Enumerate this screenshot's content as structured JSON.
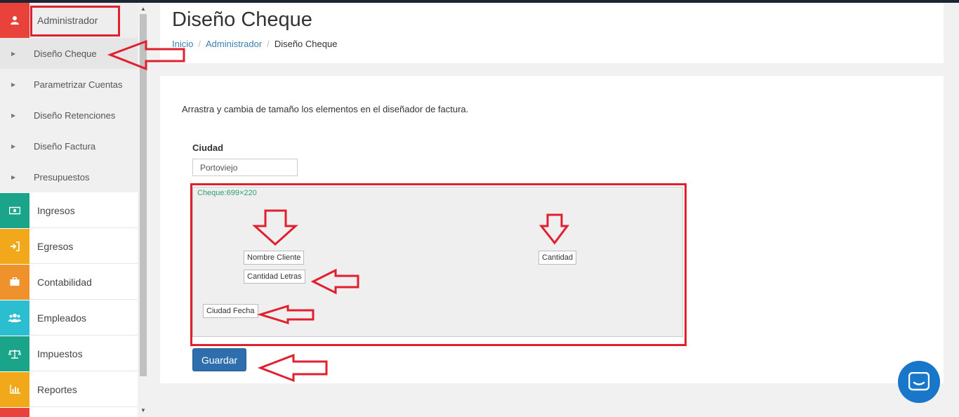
{
  "sidebar": {
    "header": {
      "label": "Administrador",
      "icon": "user-icon",
      "color": "#e8423a"
    },
    "submenu": [
      {
        "label": "Diseño Cheque",
        "active": true
      },
      {
        "label": "Parametrizar Cuentas"
      },
      {
        "label": "Diseño Retenciones"
      },
      {
        "label": "Diseño Factura"
      },
      {
        "label": "Presupuestos"
      }
    ],
    "modules": [
      {
        "label": "Ingresos",
        "icon": "money-icon",
        "color": "#1aa58a"
      },
      {
        "label": "Egresos",
        "icon": "sign-in-icon",
        "color": "#f1a81a"
      },
      {
        "label": "Contabilidad",
        "icon": "briefcase-icon",
        "color": "#f0922b"
      },
      {
        "label": "Empleados",
        "icon": "users-icon",
        "color": "#2bbdd0"
      },
      {
        "label": "Impuestos",
        "icon": "balance-scale-icon",
        "color": "#1aa58a"
      },
      {
        "label": "Reportes",
        "icon": "bar-chart-icon",
        "color": "#f1a81a"
      }
    ]
  },
  "header": {
    "title": "Diseño Cheque",
    "breadcrumb": [
      "Inicio",
      "Administrador",
      "Diseño Cheque"
    ]
  },
  "main": {
    "instructions": "Arrastra y cambia de tamaño los elementos en el diseñador de factura.",
    "ciudad_label": "Ciudad",
    "ciudad_value": "Portoviejo",
    "designer_size": "Cheque:699×220",
    "fields": {
      "nombre_cliente": "Nombre Cliente",
      "cantidad_letras": "Cantidad Letras",
      "ciudad_fecha": "Ciudad Fecha",
      "cantidad": "Cantidad"
    },
    "save_label": "Guardar"
  },
  "colors": {
    "annotation": "#e0202e",
    "link": "#3c7fb1",
    "primary": "#2f6eac"
  }
}
